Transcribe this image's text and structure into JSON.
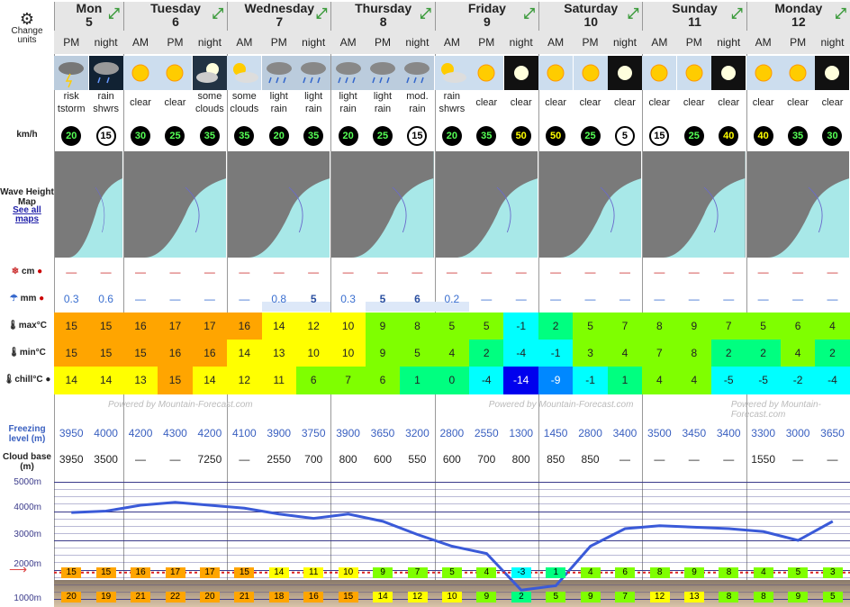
{
  "sidebar": {
    "change_units": "Change units",
    "wind_unit": "km/h",
    "wave_label": "Wave Height Map",
    "see_all": "See all maps",
    "snow": "cm",
    "rain": "mm",
    "max": "max°C",
    "min": "min°C",
    "chill": "chill°C",
    "freezing": "Freezing level (m)",
    "cloud": "Cloud base (m)",
    "alt5000": "5000m",
    "alt4000": "4000m",
    "alt3000": "3000m",
    "alt2000": "2000m",
    "alt1000": "1000m"
  },
  "days": [
    {
      "name": "Mon",
      "num": "5",
      "cols": 2
    },
    {
      "name": "Tuesday",
      "num": "6",
      "cols": 3
    },
    {
      "name": "Wednesday",
      "num": "7",
      "cols": 3
    },
    {
      "name": "Thursday",
      "num": "8",
      "cols": 3
    },
    {
      "name": "Friday",
      "num": "9",
      "cols": 3
    },
    {
      "name": "Saturday",
      "num": "10",
      "cols": 3
    },
    {
      "name": "Sunday",
      "num": "11",
      "cols": 3
    },
    {
      "name": "Monday",
      "num": "12",
      "cols": 3
    }
  ],
  "periods": [
    "PM",
    "night",
    "AM",
    "PM",
    "night",
    "AM",
    "PM",
    "night",
    "AM",
    "PM",
    "night",
    "AM",
    "PM",
    "night",
    "AM",
    "PM",
    "night",
    "AM",
    "PM",
    "night",
    "AM",
    "PM",
    "night"
  ],
  "weather": [
    "risk tstorm",
    "rain shwrs",
    "clear",
    "clear",
    "some clouds",
    "some clouds",
    "light rain",
    "light rain",
    "light rain",
    "light rain",
    "mod. rain",
    "rain shwrs",
    "clear",
    "clear",
    "clear",
    "clear",
    "clear",
    "clear",
    "clear",
    "clear",
    "clear",
    "clear",
    "clear"
  ],
  "icons": [
    "storm",
    "rain-night",
    "sun",
    "sun",
    "cloud-night",
    "sun-cloud",
    "rain",
    "rain",
    "rain",
    "rain",
    "rain",
    "sun-cloud",
    "sun",
    "moon",
    "sun",
    "sun",
    "moon",
    "sun",
    "sun",
    "moon",
    "sun",
    "sun",
    "moon"
  ],
  "wind": [
    "20",
    "15",
    "30",
    "25",
    "35",
    "35",
    "20",
    "35",
    "20",
    "25",
    "15",
    "20",
    "35",
    "50",
    "50",
    "25",
    "5",
    "15",
    "25",
    "40",
    "40",
    "35",
    "30"
  ],
  "wind_style": [
    "b",
    "w",
    "b",
    "b",
    "b",
    "b",
    "b",
    "b",
    "b",
    "b",
    "w",
    "b",
    "b",
    "y",
    "y",
    "b",
    "w",
    "w",
    "b",
    "y",
    "y",
    "b",
    "b"
  ],
  "snow": [
    "—",
    "—",
    "—",
    "—",
    "—",
    "—",
    "—",
    "—",
    "—",
    "—",
    "—",
    "—",
    "—",
    "—",
    "—",
    "—",
    "—",
    "—",
    "—",
    "—",
    "—",
    "—",
    "—"
  ],
  "rain": [
    "0.3",
    "0.6",
    "—",
    "—",
    "—",
    "—",
    "0.8",
    "5",
    "0.3",
    "5",
    "6",
    "0.2",
    "—",
    "—",
    "—",
    "—",
    "—",
    "—",
    "—",
    "—",
    "—",
    "—",
    "—"
  ],
  "max": [
    "15",
    "15",
    "16",
    "17",
    "17",
    "16",
    "14",
    "12",
    "10",
    "9",
    "8",
    "5",
    "5",
    "-1",
    "2",
    "5",
    "7",
    "8",
    "9",
    "7",
    "5",
    "6",
    "4"
  ],
  "min": [
    "15",
    "15",
    "15",
    "16",
    "16",
    "14",
    "13",
    "10",
    "10",
    "9",
    "5",
    "4",
    "2",
    "-4",
    "-1",
    "3",
    "4",
    "7",
    "8",
    "2",
    "2",
    "4",
    "2"
  ],
  "chill": [
    "14",
    "14",
    "13",
    "15",
    "14",
    "12",
    "11",
    "6",
    "7",
    "6",
    "1",
    "0",
    "-4",
    "-14",
    "-9",
    "-1",
    "1",
    "4",
    "4",
    "-5",
    "-5",
    "-2",
    "-4"
  ],
  "freezing": [
    "3950",
    "4000",
    "4200",
    "4300",
    "4200",
    "4100",
    "3900",
    "3750",
    "3900",
    "3650",
    "3200",
    "2800",
    "2550",
    "1300",
    "1450",
    "2800",
    "3400",
    "3500",
    "3450",
    "3400",
    "3300",
    "3000",
    "3650"
  ],
  "cloud": [
    "3950",
    "3500",
    "—",
    "—",
    "7250",
    "—",
    "2550",
    "700",
    "800",
    "600",
    "550",
    "600",
    "700",
    "800",
    "850",
    "850",
    "—",
    "—",
    "—",
    "—",
    "1550",
    "—",
    "—"
  ],
  "chart_temps2000": [
    "15",
    "15",
    "16",
    "17",
    "17",
    "15",
    "14",
    "11",
    "10",
    "9",
    "7",
    "5",
    "4",
    "-3",
    "1",
    "4",
    "6",
    "8",
    "9",
    "8",
    "4",
    "5",
    "3"
  ],
  "chart_temps1000": [
    "20",
    "19",
    "21",
    "22",
    "20",
    "21",
    "18",
    "16",
    "15",
    "14",
    "12",
    "10",
    "9",
    "2",
    "5",
    "9",
    "7",
    "12",
    "13",
    "8",
    "8",
    "9",
    "5"
  ],
  "powered": "Powered by Mountain-Forecast.com",
  "colors": {
    "orange": "#ffa500",
    "yellow": "#ffff00",
    "green": "#7fff00",
    "cyan": "#00ffff",
    "blue": "#0000ff"
  }
}
